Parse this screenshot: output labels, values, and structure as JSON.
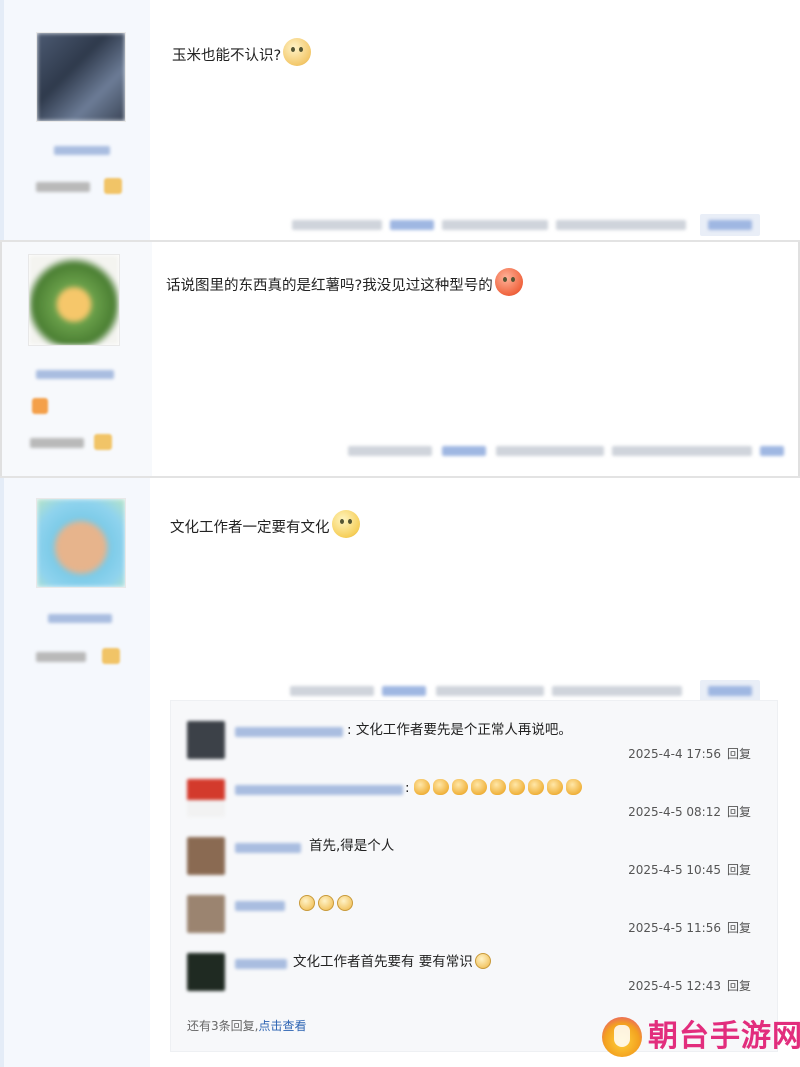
{
  "posts": [
    {
      "content": "玉米也能不认识?",
      "emoji": "grimace-face-icon"
    },
    {
      "content": "话说图里的东西真的是红薯吗?我没见过这种型号的",
      "emoji": "angry-red-face-icon"
    },
    {
      "content": "文化工作者一定要有文化",
      "emoji": "smile-face-icon"
    }
  ],
  "replies": [
    {
      "text": ": 文化工作者要先是个正常人再说吧。",
      "time": "2025-4-4 17:56",
      "reply_label": "回复"
    },
    {
      "text": ":",
      "icons": "waving-hand-icon x9",
      "time": "2025-4-5 08:12",
      "reply_label": "回复"
    },
    {
      "text": "首先,得是个人",
      "time": "2025-4-5 10:45",
      "reply_label": "回复"
    },
    {
      "text": "",
      "icons": "crying-face-icon x3",
      "time": "2025-4-5 11:56",
      "reply_label": "回复"
    },
    {
      "text": "文化工作者首先要有 要有常识",
      "time": "2025-4-5 12:43",
      "reply_label": "回复"
    }
  ],
  "more_replies": {
    "prefix": "还有3条回复,",
    "link": "点击查看"
  },
  "watermark": {
    "text": "朝台手游网"
  },
  "colors": {
    "link": "#2d64b3",
    "watermark": "#e22d7d",
    "sidebar": "#f5f8fd"
  }
}
